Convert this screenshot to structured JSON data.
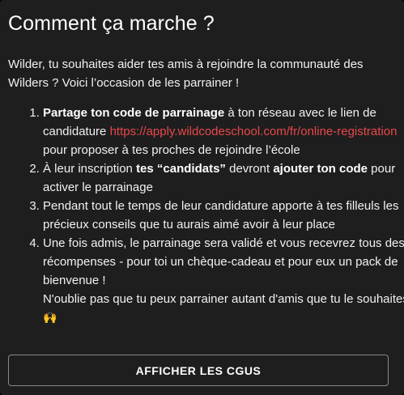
{
  "title": "Comment ça marche ?",
  "intro": "Wilder, tu souhaites aider tes amis à rejoindre la communauté des Wilders ? Voici l’occasion de les parrainer !",
  "steps": [
    {
      "bold": "Partage ton code de parrainage",
      "text_a": " à ton réseau avec le lien de candidature ",
      "link": "https://apply.wildcodeschool.com/fr/online-registration",
      "text_b": " pour proposer à tes proches de rejoindre l’école"
    },
    {
      "text_a": "À leur inscription ",
      "bold_a": "tes “candidats”",
      "text_b": " devront ",
      "bold_b": "ajouter ton code",
      "text_c": " pour activer le parrainage"
    },
    {
      "text": "Pendant tout le temps de leur candidature apporte à tes filleuls les précieux conseils que tu aurais aimé avoir à leur place"
    },
    {
      "text": "Une fois admis, le parrainage sera validé et vous recevrez tous des récompenses - pour toi un chèque-cadeau et pour eux un pack de bienvenue !",
      "text_b": "N'oublie pas que tu peux parrainer autant d'amis que tu le souhaites ! ",
      "emoji": "🙌"
    }
  ],
  "cgu_button": "AFFICHER LES CGUS",
  "colors": {
    "background": "#1e1e1e",
    "link": "#e8474a",
    "text": "#f1f1f1",
    "button_border": "#8a8a8a"
  }
}
